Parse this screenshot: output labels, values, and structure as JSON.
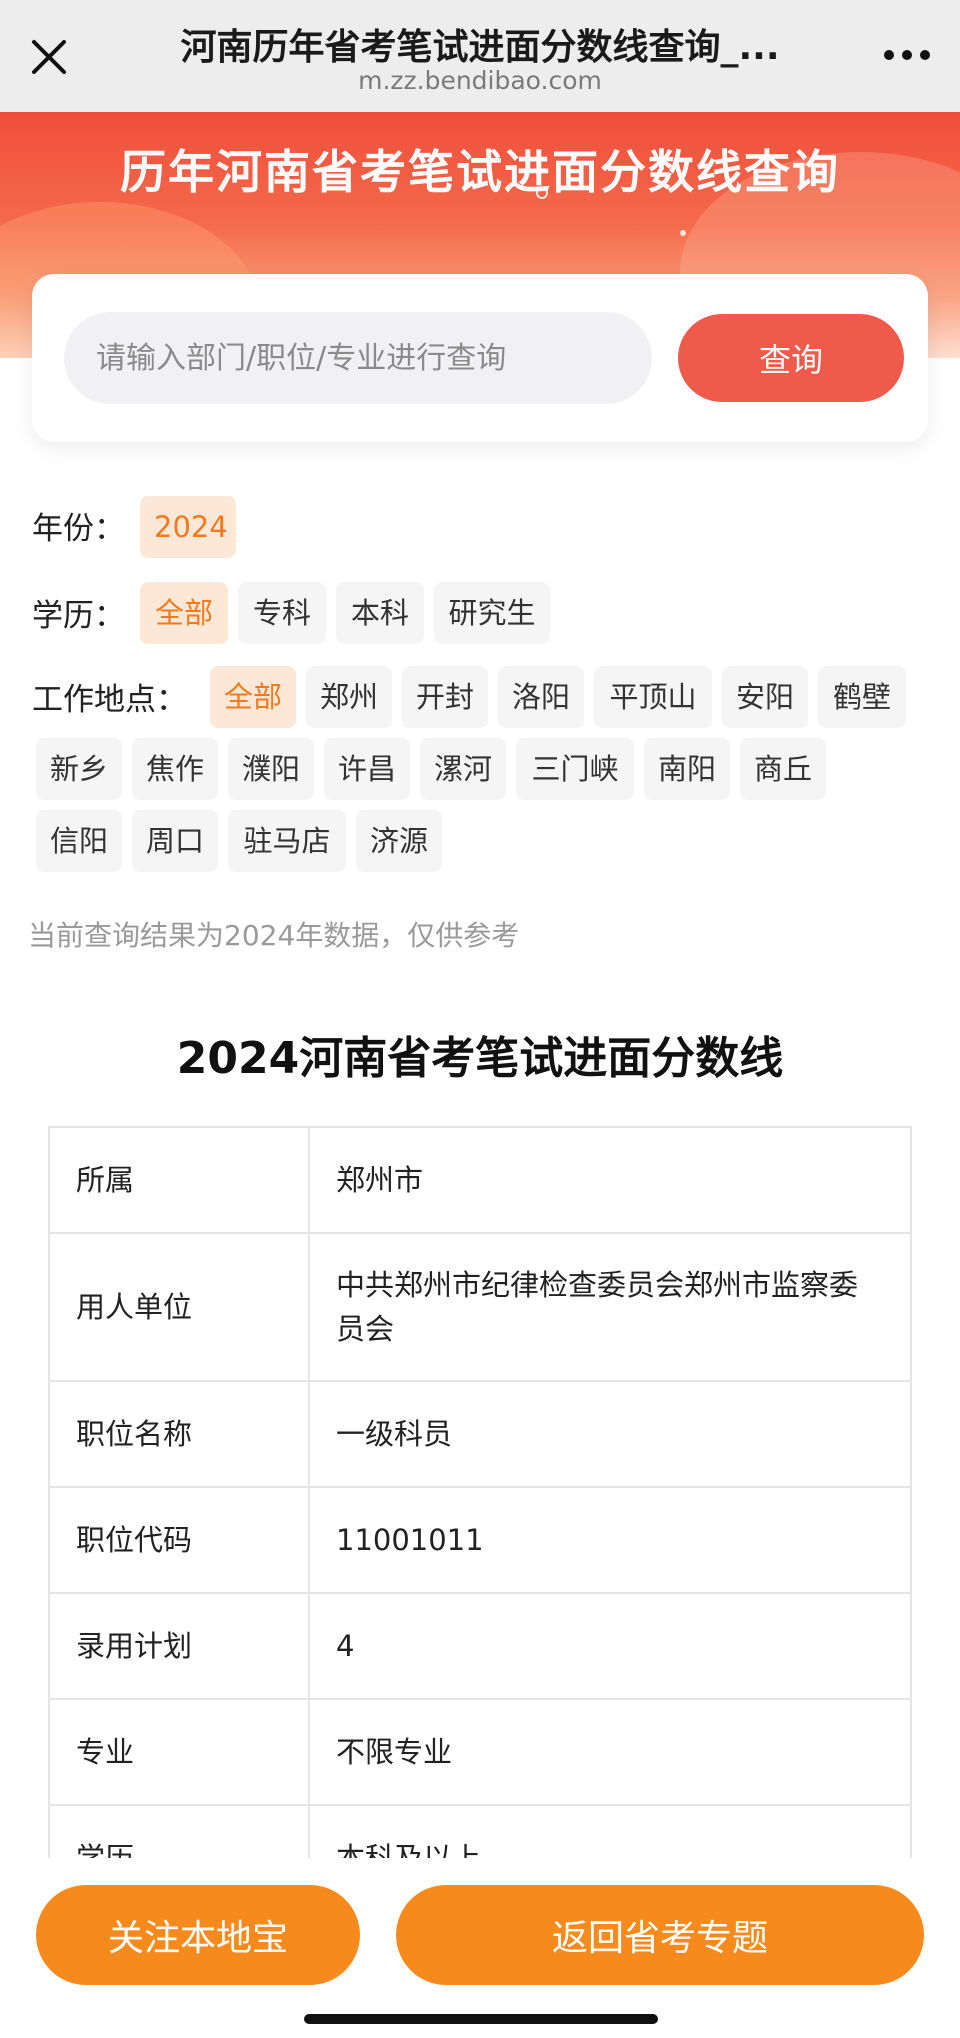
{
  "topbar": {
    "title": "河南历年省考笔试进面分数线查询_...",
    "url": "m.zz.bendibao.com"
  },
  "hero": {
    "heading": "历年河南省考笔试进面分数线查询"
  },
  "search": {
    "placeholder": "请输入部门/职位/专业进行查询",
    "button": "查询"
  },
  "filters": {
    "year": {
      "label": "年份：",
      "options": [
        "2024"
      ]
    },
    "education": {
      "label": "学历：",
      "options": [
        "全部",
        "专科",
        "本科",
        "研究生"
      ]
    },
    "location": {
      "label": "工作地点：",
      "options": [
        "全部",
        "郑州",
        "开封",
        "洛阳",
        "平顶山",
        "安阳",
        "鹤壁",
        "新乡",
        "焦作",
        "濮阳",
        "许昌",
        "漯河",
        "三门峡",
        "南阳",
        "商丘",
        "信阳",
        "周口",
        "驻马店",
        "济源"
      ]
    }
  },
  "note": "当前查询结果为2024年数据，仅供参考",
  "table": {
    "title": "2024河南省考笔试进面分数线",
    "rows": [
      {
        "key": "所属",
        "value": "郑州市"
      },
      {
        "key": "用人单位",
        "value": "中共郑州市纪律检查委员会郑州市监察委员会"
      },
      {
        "key": "职位名称",
        "value": "一级科员"
      },
      {
        "key": "职位代码",
        "value": "11001011"
      },
      {
        "key": "录用计划",
        "value": "4"
      },
      {
        "key": "专业",
        "value": "不限专业"
      },
      {
        "key": "学历",
        "value": "本科及以上"
      }
    ]
  },
  "bottom": {
    "follow": "关注本地宝",
    "back": "返回省考专题"
  },
  "colors": {
    "accent_orange": "#f78a1c",
    "search_red": "#f05a4a",
    "active_chip_bg": "#fde8d8",
    "active_chip_text": "#f07a1c"
  }
}
